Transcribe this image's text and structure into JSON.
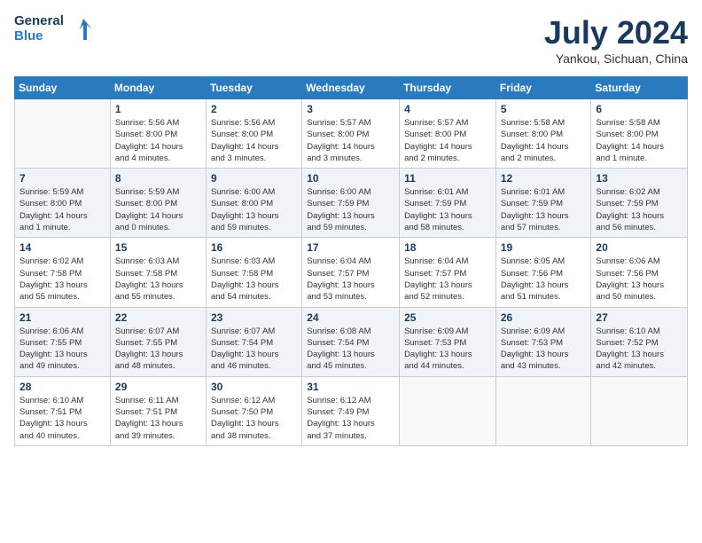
{
  "header": {
    "logo_line1": "General",
    "logo_line2": "Blue",
    "month_year": "July 2024",
    "location": "Yankou, Sichuan, China"
  },
  "weekdays": [
    "Sunday",
    "Monday",
    "Tuesday",
    "Wednesday",
    "Thursday",
    "Friday",
    "Saturday"
  ],
  "weeks": [
    [
      {
        "day": "",
        "lines": []
      },
      {
        "day": "1",
        "lines": [
          "Sunrise: 5:56 AM",
          "Sunset: 8:00 PM",
          "Daylight: 14 hours",
          "and 4 minutes."
        ]
      },
      {
        "day": "2",
        "lines": [
          "Sunrise: 5:56 AM",
          "Sunset: 8:00 PM",
          "Daylight: 14 hours",
          "and 3 minutes."
        ]
      },
      {
        "day": "3",
        "lines": [
          "Sunrise: 5:57 AM",
          "Sunset: 8:00 PM",
          "Daylight: 14 hours",
          "and 3 minutes."
        ]
      },
      {
        "day": "4",
        "lines": [
          "Sunrise: 5:57 AM",
          "Sunset: 8:00 PM",
          "Daylight: 14 hours",
          "and 2 minutes."
        ]
      },
      {
        "day": "5",
        "lines": [
          "Sunrise: 5:58 AM",
          "Sunset: 8:00 PM",
          "Daylight: 14 hours",
          "and 2 minutes."
        ]
      },
      {
        "day": "6",
        "lines": [
          "Sunrise: 5:58 AM",
          "Sunset: 8:00 PM",
          "Daylight: 14 hours",
          "and 1 minute."
        ]
      }
    ],
    [
      {
        "day": "7",
        "lines": [
          "Sunrise: 5:59 AM",
          "Sunset: 8:00 PM",
          "Daylight: 14 hours",
          "and 1 minute."
        ]
      },
      {
        "day": "8",
        "lines": [
          "Sunrise: 5:59 AM",
          "Sunset: 8:00 PM",
          "Daylight: 14 hours",
          "and 0 minutes."
        ]
      },
      {
        "day": "9",
        "lines": [
          "Sunrise: 6:00 AM",
          "Sunset: 8:00 PM",
          "Daylight: 13 hours",
          "and 59 minutes."
        ]
      },
      {
        "day": "10",
        "lines": [
          "Sunrise: 6:00 AM",
          "Sunset: 7:59 PM",
          "Daylight: 13 hours",
          "and 59 minutes."
        ]
      },
      {
        "day": "11",
        "lines": [
          "Sunrise: 6:01 AM",
          "Sunset: 7:59 PM",
          "Daylight: 13 hours",
          "and 58 minutes."
        ]
      },
      {
        "day": "12",
        "lines": [
          "Sunrise: 6:01 AM",
          "Sunset: 7:59 PM",
          "Daylight: 13 hours",
          "and 57 minutes."
        ]
      },
      {
        "day": "13",
        "lines": [
          "Sunrise: 6:02 AM",
          "Sunset: 7:59 PM",
          "Daylight: 13 hours",
          "and 56 minutes."
        ]
      }
    ],
    [
      {
        "day": "14",
        "lines": [
          "Sunrise: 6:02 AM",
          "Sunset: 7:58 PM",
          "Daylight: 13 hours",
          "and 55 minutes."
        ]
      },
      {
        "day": "15",
        "lines": [
          "Sunrise: 6:03 AM",
          "Sunset: 7:58 PM",
          "Daylight: 13 hours",
          "and 55 minutes."
        ]
      },
      {
        "day": "16",
        "lines": [
          "Sunrise: 6:03 AM",
          "Sunset: 7:58 PM",
          "Daylight: 13 hours",
          "and 54 minutes."
        ]
      },
      {
        "day": "17",
        "lines": [
          "Sunrise: 6:04 AM",
          "Sunset: 7:57 PM",
          "Daylight: 13 hours",
          "and 53 minutes."
        ]
      },
      {
        "day": "18",
        "lines": [
          "Sunrise: 6:04 AM",
          "Sunset: 7:57 PM",
          "Daylight: 13 hours",
          "and 52 minutes."
        ]
      },
      {
        "day": "19",
        "lines": [
          "Sunrise: 6:05 AM",
          "Sunset: 7:56 PM",
          "Daylight: 13 hours",
          "and 51 minutes."
        ]
      },
      {
        "day": "20",
        "lines": [
          "Sunrise: 6:06 AM",
          "Sunset: 7:56 PM",
          "Daylight: 13 hours",
          "and 50 minutes."
        ]
      }
    ],
    [
      {
        "day": "21",
        "lines": [
          "Sunrise: 6:06 AM",
          "Sunset: 7:55 PM",
          "Daylight: 13 hours",
          "and 49 minutes."
        ]
      },
      {
        "day": "22",
        "lines": [
          "Sunrise: 6:07 AM",
          "Sunset: 7:55 PM",
          "Daylight: 13 hours",
          "and 48 minutes."
        ]
      },
      {
        "day": "23",
        "lines": [
          "Sunrise: 6:07 AM",
          "Sunset: 7:54 PM",
          "Daylight: 13 hours",
          "and 46 minutes."
        ]
      },
      {
        "day": "24",
        "lines": [
          "Sunrise: 6:08 AM",
          "Sunset: 7:54 PM",
          "Daylight: 13 hours",
          "and 45 minutes."
        ]
      },
      {
        "day": "25",
        "lines": [
          "Sunrise: 6:09 AM",
          "Sunset: 7:53 PM",
          "Daylight: 13 hours",
          "and 44 minutes."
        ]
      },
      {
        "day": "26",
        "lines": [
          "Sunrise: 6:09 AM",
          "Sunset: 7:53 PM",
          "Daylight: 13 hours",
          "and 43 minutes."
        ]
      },
      {
        "day": "27",
        "lines": [
          "Sunrise: 6:10 AM",
          "Sunset: 7:52 PM",
          "Daylight: 13 hours",
          "and 42 minutes."
        ]
      }
    ],
    [
      {
        "day": "28",
        "lines": [
          "Sunrise: 6:10 AM",
          "Sunset: 7:51 PM",
          "Daylight: 13 hours",
          "and 40 minutes."
        ]
      },
      {
        "day": "29",
        "lines": [
          "Sunrise: 6:11 AM",
          "Sunset: 7:51 PM",
          "Daylight: 13 hours",
          "and 39 minutes."
        ]
      },
      {
        "day": "30",
        "lines": [
          "Sunrise: 6:12 AM",
          "Sunset: 7:50 PM",
          "Daylight: 13 hours",
          "and 38 minutes."
        ]
      },
      {
        "day": "31",
        "lines": [
          "Sunrise: 6:12 AM",
          "Sunset: 7:49 PM",
          "Daylight: 13 hours",
          "and 37 minutes."
        ]
      },
      {
        "day": "",
        "lines": []
      },
      {
        "day": "",
        "lines": []
      },
      {
        "day": "",
        "lines": []
      }
    ]
  ]
}
